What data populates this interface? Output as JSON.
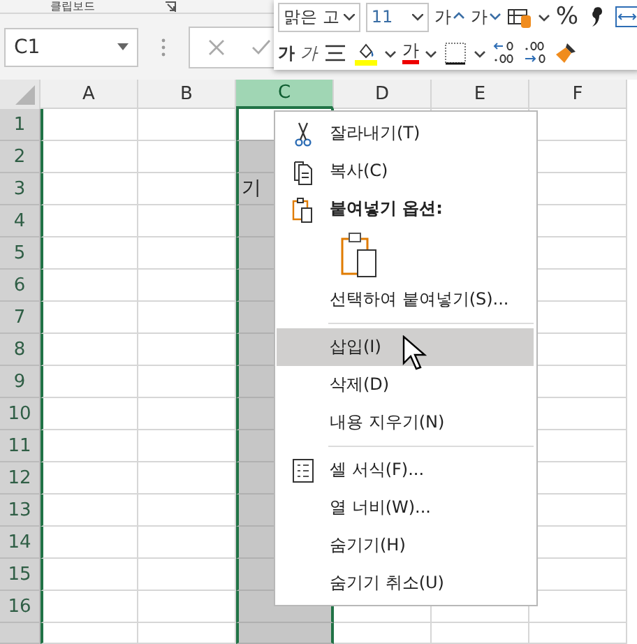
{
  "ribbon": {
    "group_label": "클립보드"
  },
  "name_box": {
    "value": "C1"
  },
  "mini_toolbar": {
    "font_name": "맑은 고",
    "font_size": "11",
    "percent": "%",
    "grow_label": "가",
    "shrink_label": "가",
    "bold_label": "가",
    "italic_label": "가",
    "font_color_label": "가"
  },
  "columns": [
    {
      "label": "A",
      "selected": false
    },
    {
      "label": "B",
      "selected": false
    },
    {
      "label": "C",
      "selected": true
    },
    {
      "label": "D",
      "selected": false
    },
    {
      "label": "E",
      "selected": false
    },
    {
      "label": "F",
      "selected": false
    }
  ],
  "rows": [
    {
      "label": "1"
    },
    {
      "label": "2"
    },
    {
      "label": "3",
      "column_c_text": "기"
    },
    {
      "label": "4"
    },
    {
      "label": "5"
    },
    {
      "label": "6"
    },
    {
      "label": "7"
    },
    {
      "label": "8"
    },
    {
      "label": "9"
    },
    {
      "label": "10"
    },
    {
      "label": "11"
    },
    {
      "label": "12"
    },
    {
      "label": "13"
    },
    {
      "label": "14"
    },
    {
      "label": "15"
    },
    {
      "label": "16"
    }
  ],
  "context_menu": [
    {
      "kind": "item",
      "label": "잘라내기(T)",
      "selected": false
    },
    {
      "kind": "item",
      "label": "복사(C)",
      "selected": false
    },
    {
      "kind": "header",
      "label": "붙여넣기 옵션:"
    },
    {
      "kind": "paste_options"
    },
    {
      "kind": "item",
      "label": "선택하여 붙여넣기(S)...",
      "selected": false
    },
    {
      "kind": "separator"
    },
    {
      "kind": "item",
      "label": "삽입(I)",
      "selected": true
    },
    {
      "kind": "item",
      "label": "삭제(D)",
      "selected": false
    },
    {
      "kind": "item",
      "label": "내용 지우기(N)",
      "selected": false
    },
    {
      "kind": "separator"
    },
    {
      "kind": "item",
      "label": "셀 서식(F)...",
      "selected": false
    },
    {
      "kind": "item",
      "label": "열 너비(W)...",
      "selected": false
    },
    {
      "kind": "item",
      "label": "숨기기(H)",
      "selected": false
    },
    {
      "kind": "item",
      "label": "숨기기 취소(U)",
      "selected": false
    }
  ]
}
